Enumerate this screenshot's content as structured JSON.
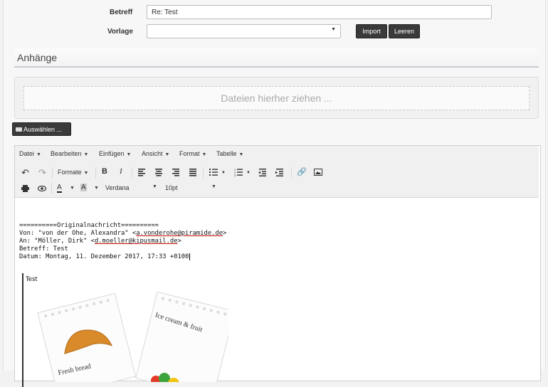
{
  "form": {
    "subject_label": "Betreff",
    "subject_value": "Re: Test",
    "template_label": "Vorlage",
    "template_value": "",
    "import_label": "Import",
    "clear_label": "Leeren"
  },
  "attachments": {
    "title": "Anhänge",
    "dropzone_text": "Dateien hierher ziehen ...",
    "select_label": "Auswählen ..."
  },
  "editor": {
    "menu": [
      "Datei",
      "Bearbeiten",
      "Einfügen",
      "Ansicht",
      "Format",
      "Tabelle"
    ],
    "formats_label": "Formate",
    "font_family": "Verdana",
    "font_size": "10pt",
    "content": {
      "separator": "==========Originalnachricht==========",
      "from_prefix": "Von: \"von der Ohe, Alexandra\" <",
      "from_email": "a.vonderohe@piramide.de",
      "to_prefix": "An: \"Möller, Dirk\" <",
      "to_email": "d.moeller@kipusmail.de",
      "subject_line": "Betreff: Test",
      "date_line": "Datum: Montag, 11. Dezember 2017, 17:33 +0100",
      "quote_text": "Test",
      "card1_text": "Fresh bread",
      "card2_text": "Ice cream & fruit"
    }
  }
}
